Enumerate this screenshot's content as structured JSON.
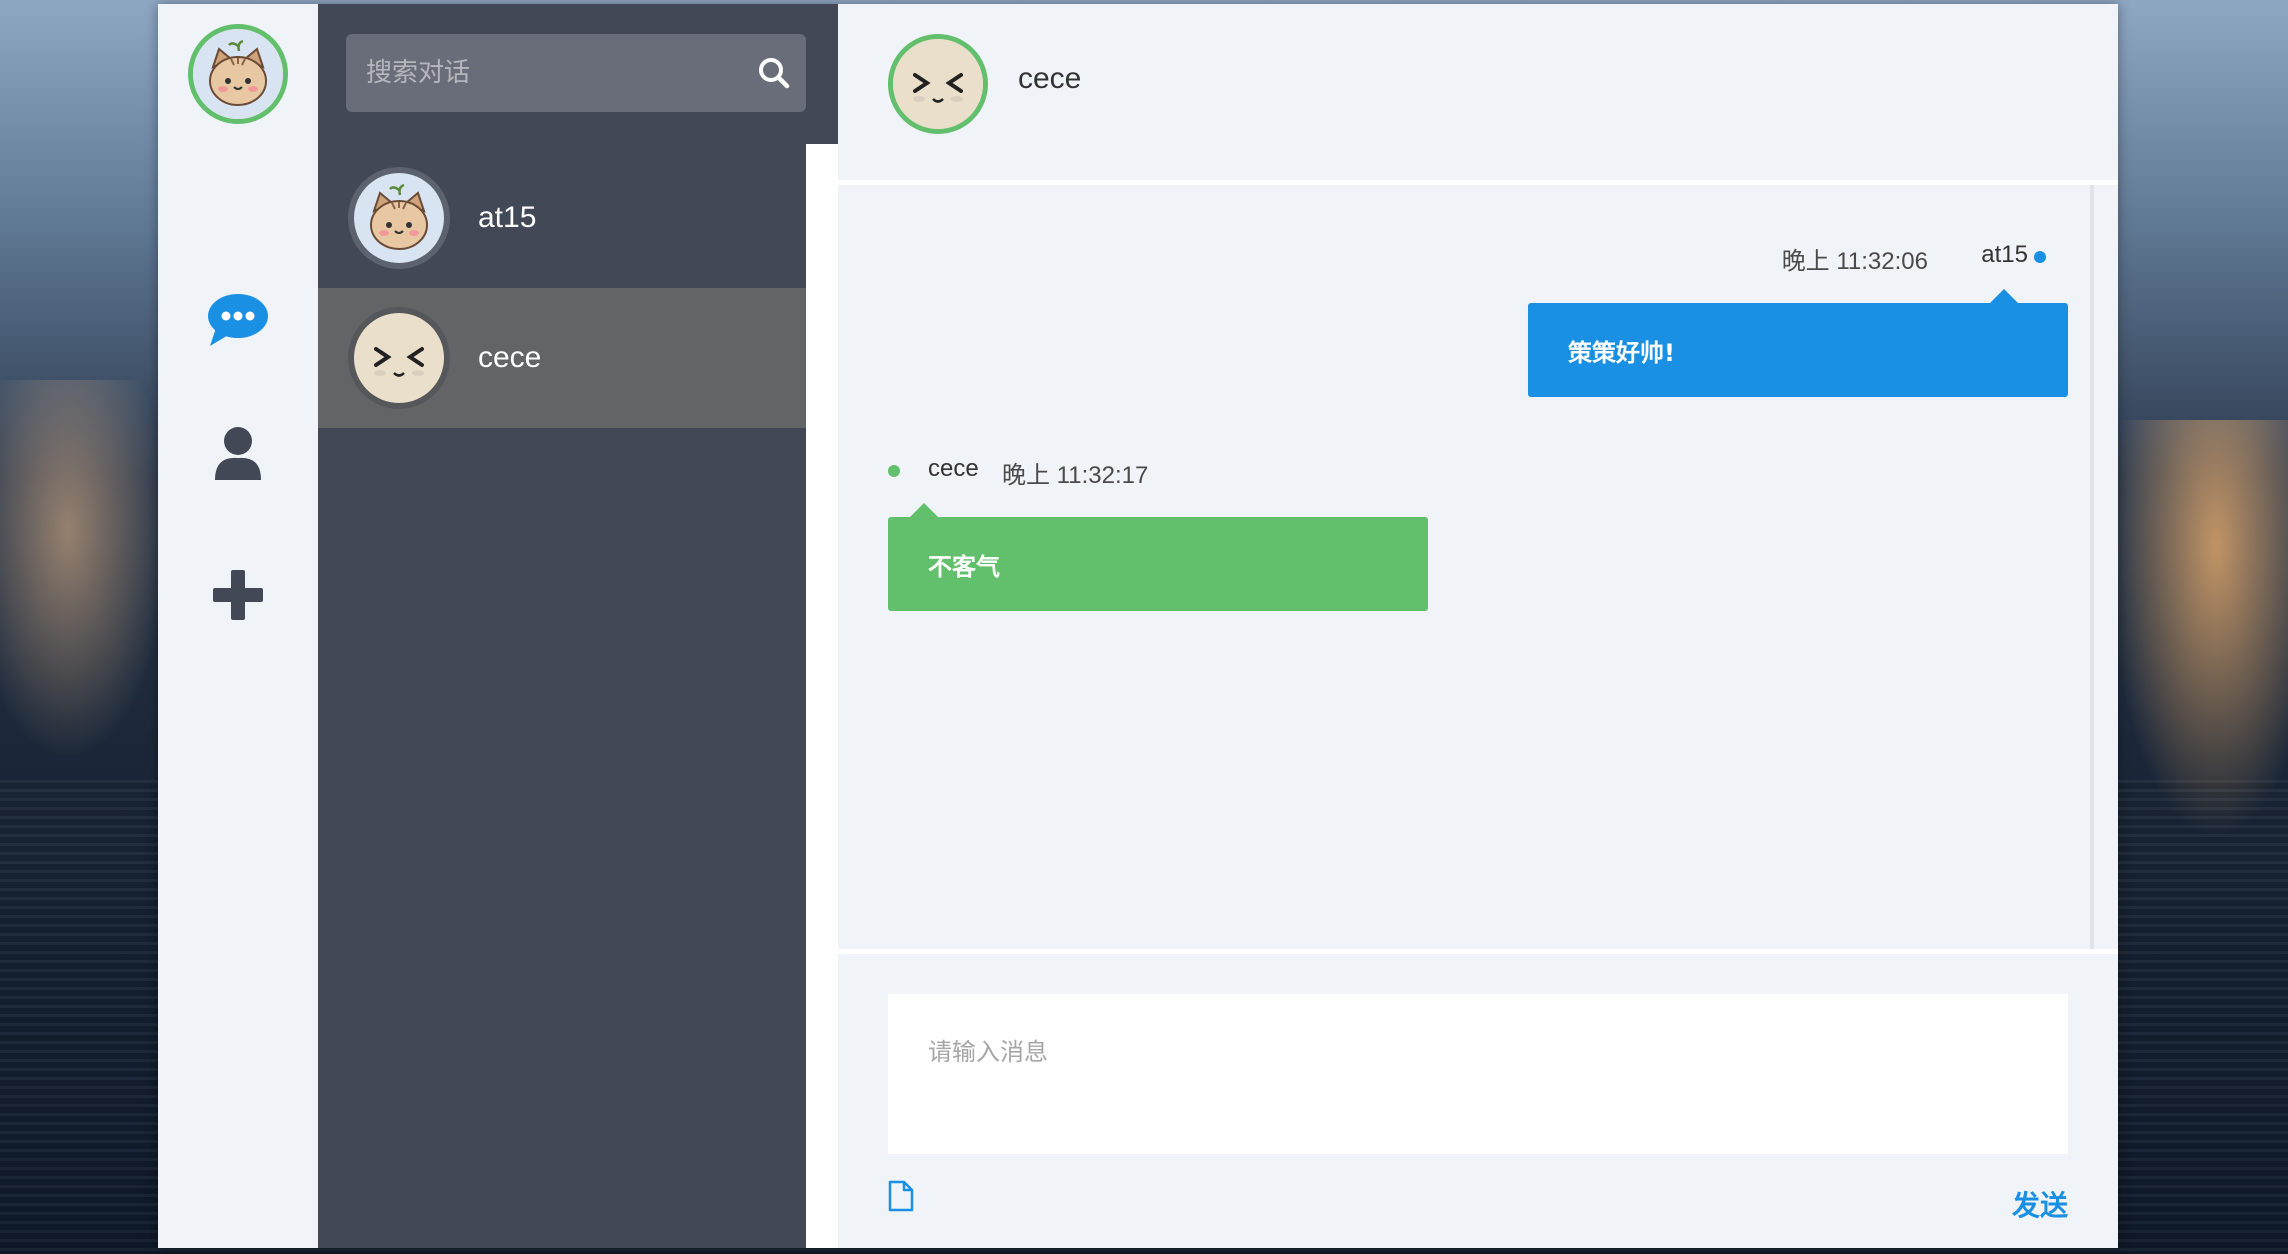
{
  "search": {
    "placeholder": "搜索对话"
  },
  "conversations": [
    {
      "name": "at15",
      "active": false
    },
    {
      "name": "cece",
      "active": true
    }
  ],
  "chat": {
    "title": "cece",
    "messages": [
      {
        "sender": "at15",
        "time": "晚上 11:32:06",
        "text": "策策好帅!",
        "side": "right"
      },
      {
        "sender": "cece",
        "time": "晚上 11:32:17",
        "text": "不客气",
        "side": "left"
      }
    ]
  },
  "composer": {
    "placeholder": "请输入消息",
    "send_label": "发送"
  },
  "icons": {
    "rail": [
      "chat-bubble-icon",
      "user-icon",
      "plus-icon"
    ],
    "search": "search-icon",
    "attach": "file-icon"
  },
  "colors": {
    "accent_blue": "#1990e3",
    "accent_green": "#62c06c",
    "sidebar": "#424856",
    "active_item": "#636466"
  }
}
